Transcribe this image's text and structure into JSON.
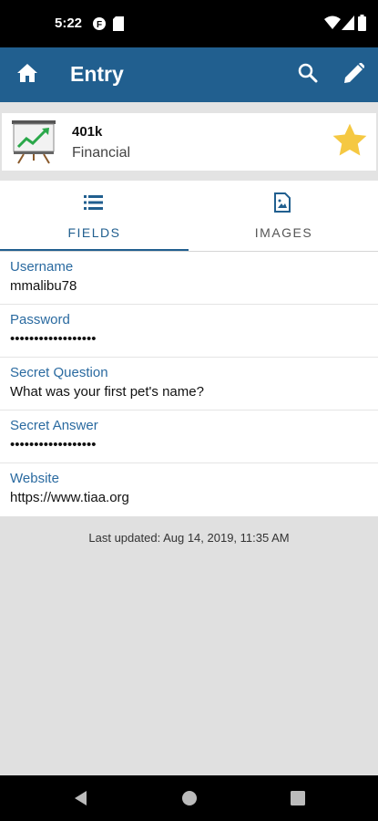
{
  "status_bar": {
    "time": "5:22",
    "icons": [
      "f-badge-icon",
      "sd-card-icon",
      "wifi-icon",
      "signal-icon",
      "battery-icon"
    ]
  },
  "app_bar": {
    "title": "Entry",
    "color": "#215f8f",
    "actions": [
      "home-icon",
      "search-icon",
      "edit-icon"
    ]
  },
  "entry": {
    "name": "401k",
    "category": "Financial",
    "icon": "chart-easel-icon",
    "favorite": true,
    "star_color": "#f5c842"
  },
  "tabs": [
    {
      "label": "FIELDS",
      "icon": "list-icon",
      "active": true
    },
    {
      "label": "IMAGES",
      "icon": "image-file-icon",
      "active": false
    }
  ],
  "fields": [
    {
      "label": "Username",
      "value": "mmalibu78",
      "masked": false
    },
    {
      "label": "Password",
      "value": "••••••••••••••••••",
      "masked": true
    },
    {
      "label": "Secret Question",
      "value": "What was your first pet's name?",
      "masked": false
    },
    {
      "label": "Secret Answer",
      "value": "••••••••••••••••••",
      "masked": true
    },
    {
      "label": "Website",
      "value": "https://www.tiaa.org",
      "masked": false
    }
  ],
  "last_updated": "Last updated: Aug 14, 2019, 11:35 AM",
  "nav_bar": [
    "back-icon",
    "home-circle-icon",
    "recents-icon"
  ]
}
